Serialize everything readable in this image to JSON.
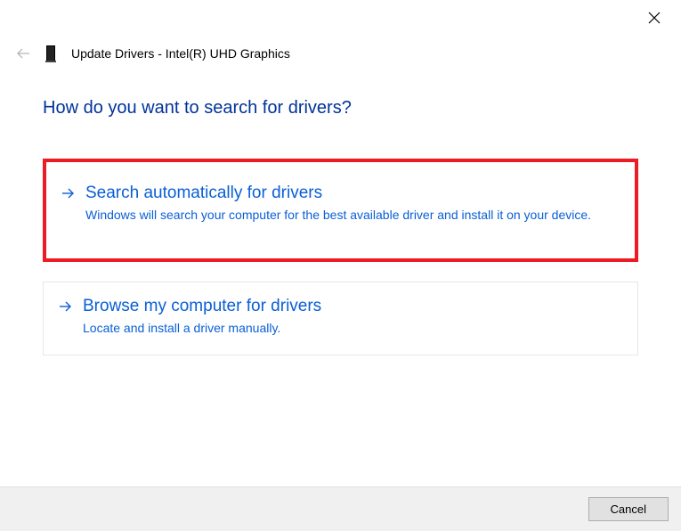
{
  "window": {
    "title": "Update Drivers - Intel(R) UHD Graphics"
  },
  "content": {
    "prompt": "How do you want to search for drivers?"
  },
  "options": [
    {
      "title": "Search automatically for drivers",
      "description": "Windows will search your computer for the best available driver and install it on your device."
    },
    {
      "title": "Browse my computer for drivers",
      "description": "Locate and install a driver manually."
    }
  ],
  "footer": {
    "cancel_label": "Cancel"
  }
}
